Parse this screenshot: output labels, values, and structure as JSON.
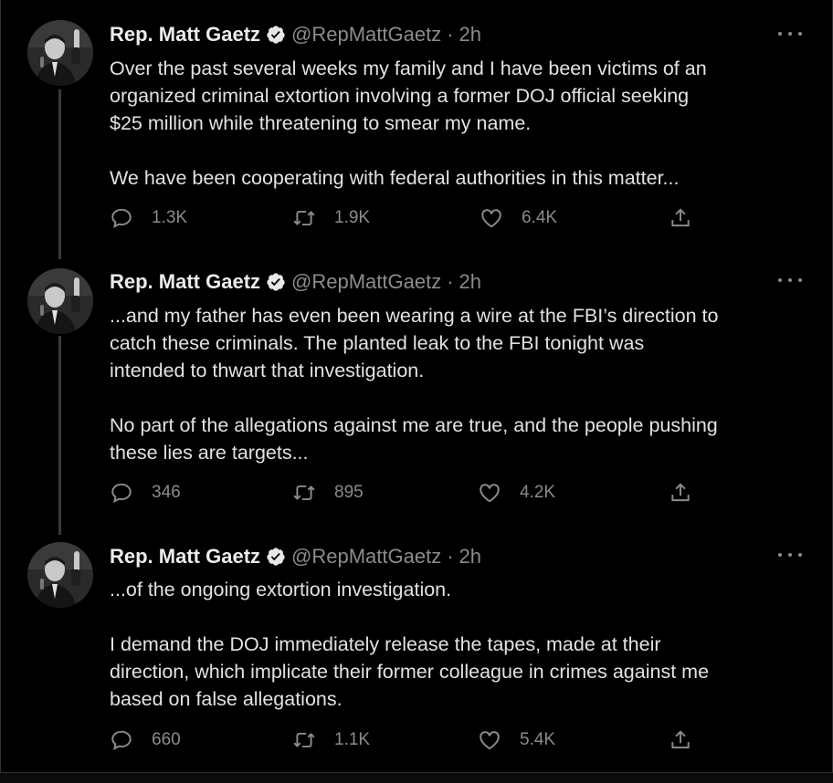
{
  "tweets": [
    {
      "author_name": "Rep. Matt Gaetz",
      "handle": "@RepMattGaetz",
      "separator": "·",
      "time": "2h",
      "paragraphs": [
        "Over the past several weeks my family and I have been victims of an\norganized criminal extortion involving a former DOJ official seeking\n$25 million while threatening to smear my name.",
        "We have been cooperating with federal authorities in this matter..."
      ],
      "replies": "1.3K",
      "retweets": "1.9K",
      "likes": "6.4K"
    },
    {
      "author_name": "Rep. Matt Gaetz",
      "handle": "@RepMattGaetz",
      "separator": "·",
      "time": "2h",
      "paragraphs": [
        "...and my father has even been wearing a wire at the FBI’s direction to\ncatch these criminals. The planted leak to the FBI tonight was\nintended to thwart that investigation.",
        "No part of the allegations against me are true, and the people pushing\nthese lies are targets..."
      ],
      "replies": "346",
      "retweets": "895",
      "likes": "4.2K"
    },
    {
      "author_name": "Rep. Matt Gaetz",
      "handle": "@RepMattGaetz",
      "separator": "·",
      "time": "2h",
      "paragraphs": [
        "...of the ongoing extortion investigation.",
        "I demand the DOJ immediately release the tapes, made at their\ndirection, which implicate their former colleague in crimes against me\nbased on false allegations."
      ],
      "replies": "660",
      "retweets": "1.1K",
      "likes": "5.4K"
    }
  ],
  "icons": {
    "verified": "verified-badge-icon",
    "reply": "reply-icon",
    "retweet": "retweet-icon",
    "like": "heart-icon",
    "share": "share-icon",
    "more": "more-icon"
  },
  "colors": {
    "background": "#000000",
    "text": "#e2e2e2",
    "muted": "#8b8b8b",
    "thread_line": "#3a3a3a"
  }
}
